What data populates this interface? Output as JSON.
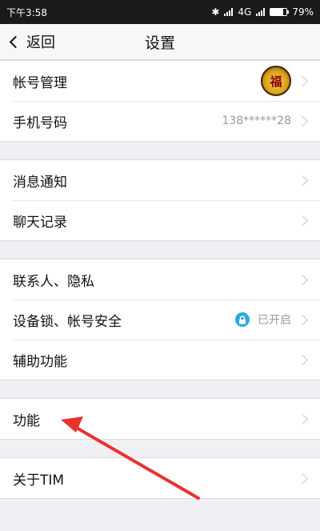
{
  "status_bar": {
    "time": "下午3:58",
    "network": "4G",
    "battery": "79%",
    "battery_level": 0.79
  },
  "nav": {
    "back_label": "返回",
    "title": "设置"
  },
  "groups": [
    [
      {
        "label": "帐号管理",
        "avatar_char": "福"
      },
      {
        "label": "手机号码",
        "value": "138******28"
      }
    ],
    [
      {
        "label": "消息通知"
      },
      {
        "label": "聊天记录"
      }
    ],
    [
      {
        "label": "联系人、隐私"
      },
      {
        "label": "设备锁、帐号安全",
        "value": "已开启"
      },
      {
        "label": "辅助功能"
      }
    ],
    [
      {
        "label": "功能"
      }
    ],
    [
      {
        "label": "关于TIM"
      }
    ]
  ],
  "colors": {
    "annotation_arrow": "#e8322f",
    "lock_badge": "#2ea7e0"
  }
}
